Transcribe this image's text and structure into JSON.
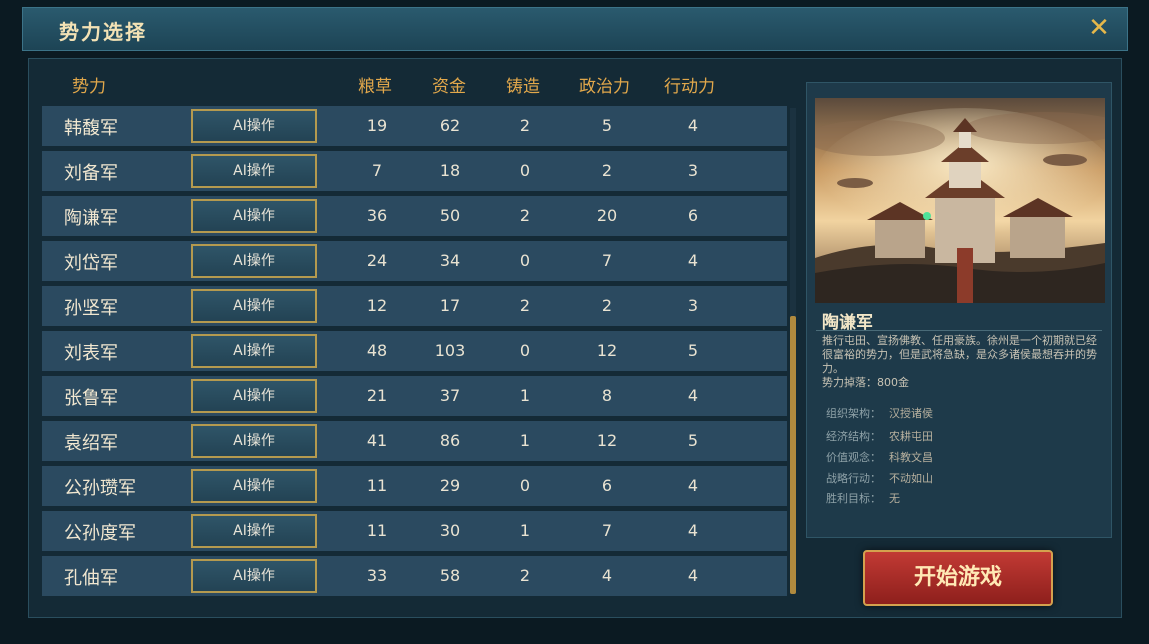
{
  "window": {
    "title": "势力选择",
    "close_symbol": "✕"
  },
  "table": {
    "headers": [
      "势力",
      "粮草",
      "资金",
      "铸造",
      "政治力",
      "行动力"
    ],
    "rows": [
      {
        "name": "韩馥军",
        "button": "AI操作",
        "grain": "19",
        "funds": "62",
        "cast": "2",
        "politics": "5",
        "action": "4"
      },
      {
        "name": "刘备军",
        "button": "AI操作",
        "grain": "7",
        "funds": "18",
        "cast": "0",
        "politics": "2",
        "action": "3"
      },
      {
        "name": "陶谦军",
        "button": "AI操作",
        "grain": "36",
        "funds": "50",
        "cast": "2",
        "politics": "20",
        "action": "6"
      },
      {
        "name": "刘岱军",
        "button": "AI操作",
        "grain": "24",
        "funds": "34",
        "cast": "0",
        "politics": "7",
        "action": "4"
      },
      {
        "name": "孙坚军",
        "button": "AI操作",
        "grain": "12",
        "funds": "17",
        "cast": "2",
        "politics": "2",
        "action": "3"
      },
      {
        "name": "刘表军",
        "button": "AI操作",
        "grain": "48",
        "funds": "103",
        "cast": "0",
        "politics": "12",
        "action": "5"
      },
      {
        "name": "张鲁军",
        "button": "AI操作",
        "grain": "21",
        "funds": "37",
        "cast": "1",
        "politics": "8",
        "action": "4"
      },
      {
        "name": "袁绍军",
        "button": "AI操作",
        "grain": "41",
        "funds": "86",
        "cast": "1",
        "politics": "12",
        "action": "5"
      },
      {
        "name": "公孙瓒军",
        "button": "AI操作",
        "grain": "11",
        "funds": "29",
        "cast": "0",
        "politics": "6",
        "action": "4"
      },
      {
        "name": "公孙度军",
        "button": "AI操作",
        "grain": "11",
        "funds": "30",
        "cast": "1",
        "politics": "7",
        "action": "4"
      },
      {
        "name": "孔伷军",
        "button": "AI操作",
        "grain": "33",
        "funds": "58",
        "cast": "2",
        "politics": "4",
        "action": "4"
      }
    ]
  },
  "detail": {
    "title": "陶谦军",
    "description": "推行屯田、宣扬佛教、任用豪族。徐州是一个初期就已经很富裕的势力，但是武将急缺，是众多诸侯最想吞并的势力。",
    "drop": "势力掉落：800金",
    "fields": [
      {
        "label": "组织架构：",
        "value": "汉授诸侯"
      },
      {
        "label": "经济结构：",
        "value": "农耕屯田"
      },
      {
        "label": "价值观念：",
        "value": "科教文昌"
      },
      {
        "label": "战略行动：",
        "value": "不动如山"
      },
      {
        "label": "胜利目标：",
        "value": "无"
      }
    ]
  },
  "start_button": "开始游戏",
  "colors": {
    "header_gold": "#e2a84b",
    "row_bg": "#2b4a60",
    "start_red": "#c23a34"
  }
}
